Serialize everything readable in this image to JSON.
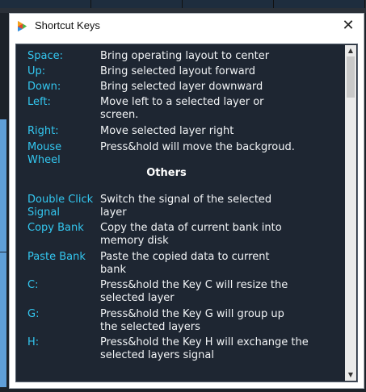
{
  "window": {
    "title": "Shortcut Keys"
  },
  "shortcuts": [
    {
      "key": "Space:",
      "desc": "Bring operating layout to center"
    },
    {
      "key": "Up:",
      "desc": "Bring selected layout forward"
    },
    {
      "key": "Down:",
      "desc": "Bring selected layer downward"
    },
    {
      "key": "Left:",
      "desc": "Move left to a selected layer or screen."
    },
    {
      "key": "Right:",
      "desc": "Move selected layer right"
    },
    {
      "key": "Mouse Wheel",
      "desc": "Press&hold will move the backgroud."
    }
  ],
  "others_heading": "Others",
  "others": [
    {
      "key": "Double Click Signal",
      "desc": "Switch the signal of the selected layer"
    },
    {
      "key": "Copy Bank",
      "desc": "Copy the data of current bank into memory disk"
    },
    {
      "key": "Paste Bank",
      "desc": "Paste the copied data to current bank"
    },
    {
      "key": "C:",
      "desc": "Press&hold the Key C will resize the selected layer"
    },
    {
      "key": "G:",
      "desc": "Press&hold the Key G will group up the selected layers"
    },
    {
      "key": "H:",
      "desc": "Press&hold the Key H will exchange the selected layers signal"
    }
  ],
  "icons": {
    "app": "app-logo-icon",
    "close": "close-icon",
    "scroll_up": "scroll-up-arrow-icon",
    "scroll_down": "scroll-down-arrow-icon"
  },
  "colors": {
    "key_text": "#33c7f0",
    "panel_bg": "#1e2632",
    "desc_text": "#f2f4f6"
  }
}
